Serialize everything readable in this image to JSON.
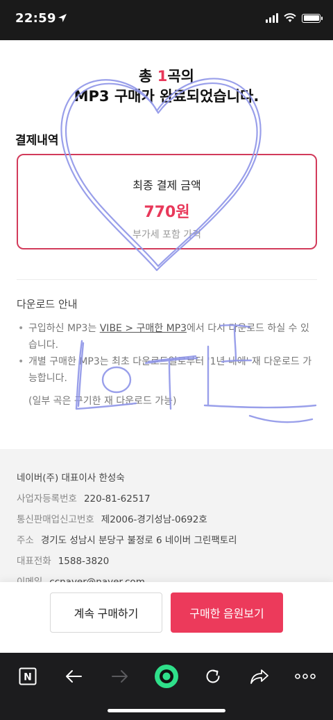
{
  "status_bar": {
    "time": "22:59"
  },
  "header": {
    "line1_prefix": "총 ",
    "line1_count": "1",
    "line1_suffix": "곡의",
    "line2": "MP3 구매가 완료되었습니다."
  },
  "payment": {
    "section_title": "결제내역",
    "final_label": "최종 결제 금액",
    "amount": "770원",
    "vat_note": "부가세 포함 가격"
  },
  "download": {
    "title": "다운로드 안내",
    "item1_before": "구입하신 MP3는 ",
    "item1_link": "VIBE > 구매한 MP3",
    "item1_after": "에서 다시 다운로드 하실 수 있습니다.",
    "item2": "개별 구매한 MP3는 최초 다운로드일로부터 '1년 내에' 재 다운로드 가능합니다.",
    "item2_note": "(일부 곡은 구기한 재 다운로드 가능)"
  },
  "footer": {
    "company": "네이버(주) 대표이사 한성숙",
    "biz_reg_label": "사업자등록번호",
    "biz_reg_value": "220-81-62517",
    "ecommerce_label": "통신판매업신고번호",
    "ecommerce_value": "제2006-경기성남-0692호",
    "address_label": "주소",
    "address_value": "경기도 성남시 분당구 불정로 6 네이버 그린팩토리",
    "phone_label": "대표전화",
    "phone_value": "1588-3820",
    "email_label": "이메일",
    "email_value": "ccnaver@naver.com"
  },
  "actions": {
    "continue_label": "계속 구매하기",
    "view_label": "구매한 음원보기"
  },
  "toolbar": {
    "n_label": "N",
    "icons": [
      "naver-n-icon",
      "back-arrow-icon",
      "forward-arrow-icon",
      "home-green-circle-icon",
      "reload-icon",
      "share-icon",
      "more-icon"
    ]
  },
  "colors": {
    "accent": "#e8385a",
    "box_border": "#d23a5a",
    "doodle": "#8f95e8",
    "toolbar_bg": "#1c1c1e",
    "green": "#2fdf8a"
  },
  "doodle_text": "LOFI"
}
